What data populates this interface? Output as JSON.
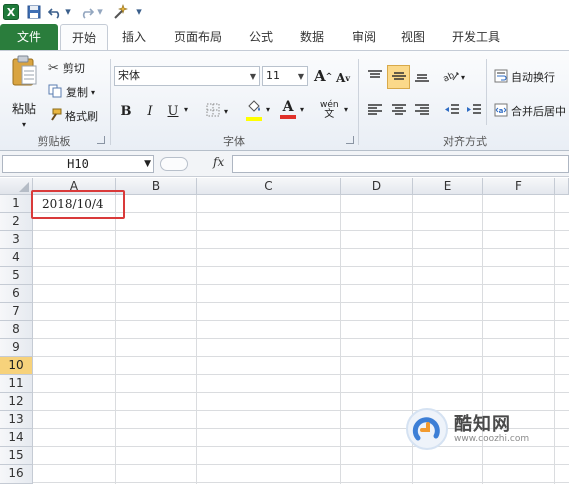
{
  "qat": {
    "excel_icon": "excel-icon",
    "save_icon": "save-icon",
    "undo_icon": "undo-icon",
    "redo_icon": "redo-icon",
    "tools_icon": "magic-wand-icon"
  },
  "tabs": [
    {
      "label": "文件"
    },
    {
      "label": "开始"
    },
    {
      "label": "插入"
    },
    {
      "label": "页面布局"
    },
    {
      "label": "公式"
    },
    {
      "label": "数据"
    },
    {
      "label": "审阅"
    },
    {
      "label": "视图"
    },
    {
      "label": "开发工具"
    }
  ],
  "ribbon": {
    "clipboard": {
      "paste": "粘贴",
      "cut": "剪切",
      "copy": "复制",
      "format_painter": "格式刷",
      "group_label": "剪贴板"
    },
    "font": {
      "font_name": "宋体",
      "font_size": "11",
      "bold": "B",
      "italic": "I",
      "underline": "U",
      "grow": "A",
      "shrink": "A",
      "font_color_letter": "A",
      "phonetic": "wén",
      "group_label": "字体"
    },
    "alignment": {
      "wrap_text": "自动换行",
      "merge_center": "合并后居中",
      "group_label": "对齐方式"
    }
  },
  "formula_bar": {
    "name_box": "H10",
    "fx": "fx",
    "value": ""
  },
  "grid": {
    "columns": [
      "A",
      "B",
      "C",
      "D",
      "E",
      "F"
    ],
    "rows": [
      "1",
      "2",
      "3",
      "4",
      "5",
      "6",
      "7",
      "8",
      "9",
      "10",
      "11",
      "12",
      "13",
      "14",
      "15",
      "16"
    ],
    "selected_row": "10",
    "cell_a1": "2018/10/4"
  },
  "watermark": {
    "title": "酷知网",
    "url": "www.coozhi.com"
  },
  "colors": {
    "file_tab": "#2a7d3c",
    "highlight": "#d93a3a",
    "selected_row_header": "#f7d27b"
  }
}
